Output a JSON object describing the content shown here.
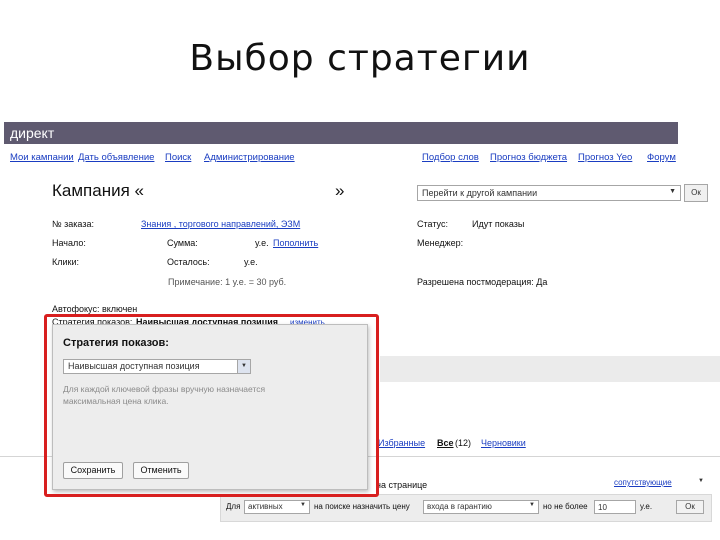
{
  "slide_title": "Выбор стратегии",
  "brand": "директ",
  "nav_left": [
    "Мои кампании",
    "Дать объявление",
    "Поиск",
    "Администрирование"
  ],
  "nav_right": [
    "Подбор слов",
    "Прогноз бюджета",
    "Прогноз Yeo",
    "Форум"
  ],
  "campaign": {
    "title_open": "Кампания «",
    "title_close": "»",
    "switch_select": "Перейти к другой кампании",
    "go_button": "Ок"
  },
  "info": {
    "order_label": "№ заказа:",
    "order_link": "Знания , торгового направлений, ЭЗМ",
    "start_label": "Начало:",
    "sum_label": "Сумма:",
    "sum_unit": "у.е.",
    "sum_link": "Пополнить",
    "clicks_label": "Клики:",
    "remain_label": "Осталось:",
    "remain_unit": "у.е.",
    "note": "Примечание: 1 у.е. = 30 руб.",
    "status_label": "Статус:",
    "status_value": "Идут показы",
    "manager_label": "Менеджер:",
    "moderation": "Разрешена постмодерация: Да"
  },
  "autofocus": "Автофокус: включен",
  "strategy_line": {
    "label": "Стратегия показов:",
    "value": "Наивысшая доступная позиция",
    "change_link": "изменить"
  },
  "tabs": {
    "favorites": "Избранные",
    "all": "Все",
    "all_count": "(12)",
    "new": "Черновики"
  },
  "on_page_text": "на странице",
  "settings_dropdown": "сопутствующие",
  "bottom_bar": {
    "for_label": "Для",
    "active_select": "активных",
    "set_price_text": "на поиске назначить цену",
    "price_select": "входа в гарантию",
    "not_more_text": "но не более",
    "amount_value": "10",
    "unit": "у.е.",
    "ok_button": "Ок"
  },
  "popup": {
    "title": "Стратегия показов:",
    "select_value": "Наивысшая доступная позиция",
    "hint": "Для каждой ключевой фразы вручную назначается максимальная цена клика.",
    "save_button": "Сохранить",
    "cancel_button": "Отменить"
  },
  "colors": {
    "brand_bar": "#5f5a70",
    "link": "#1a3dc1",
    "highlight": "#d81f1f"
  }
}
